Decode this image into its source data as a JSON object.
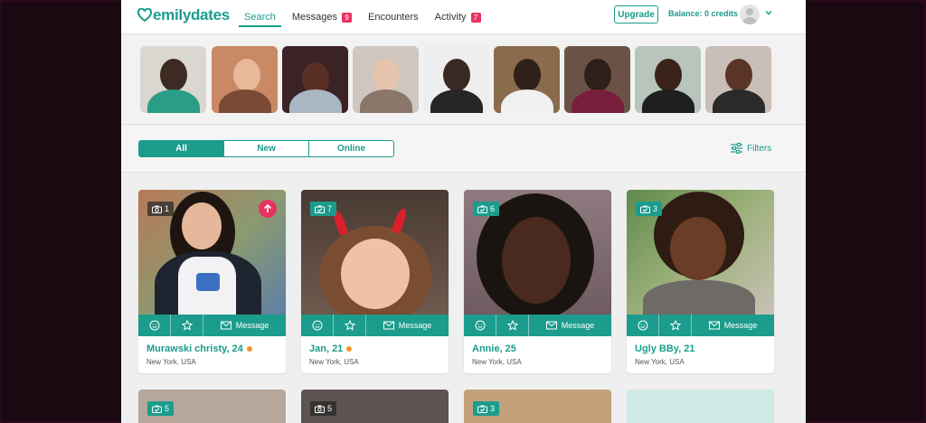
{
  "header": {
    "logo_text": "emilydates",
    "nav": [
      {
        "label": "Search",
        "active": true,
        "badge": ""
      },
      {
        "label": "Messages",
        "active": false,
        "badge": "9"
      },
      {
        "label": "Encounters",
        "active": false,
        "badge": ""
      },
      {
        "label": "Activity",
        "active": false,
        "badge": "7"
      }
    ],
    "upgrade_label": "Upgrade",
    "balance_text": "Balance: 0 credits"
  },
  "stories": [
    {
      "icon": "profile-photo"
    },
    {
      "icon": "profile-photo"
    },
    {
      "icon": "profile-photo"
    },
    {
      "icon": "profile-photo"
    },
    {
      "icon": "profile-photo"
    },
    {
      "icon": "profile-photo"
    },
    {
      "icon": "profile-photo"
    },
    {
      "icon": "profile-photo"
    },
    {
      "icon": "profile-photo"
    }
  ],
  "filter_tabs": [
    {
      "label": "All",
      "active": true
    },
    {
      "label": "New",
      "active": false
    },
    {
      "label": "Online",
      "active": false
    }
  ],
  "filters_label": "Filters",
  "profiles": [
    {
      "name": "Murawski christy, 24",
      "location": "New York, USA",
      "photo_count": "1",
      "count_style": "camera-icon",
      "online": true,
      "boosted": true
    },
    {
      "name": "Jan, 21",
      "location": "New York, USA",
      "photo_count": "7",
      "count_style": "verified-photo-icon",
      "online": true,
      "boosted": false
    },
    {
      "name": "Annie, 25",
      "location": "New York, USA",
      "photo_count": "6",
      "count_style": "verified-photo-icon",
      "online": false,
      "boosted": false
    },
    {
      "name": "Ugly BBy, 21",
      "location": "New York, USA",
      "photo_count": "3",
      "count_style": "verified-photo-icon",
      "online": false,
      "boosted": false
    }
  ],
  "profiles_row2": [
    {
      "photo_count": "5",
      "count_style": "verified-photo-icon"
    },
    {
      "photo_count": "5",
      "count_style": "camera-icon"
    },
    {
      "photo_count": "3",
      "count_style": "verified-photo-icon"
    },
    {
      "photo_count": "",
      "count_style": ""
    }
  ],
  "card_actions": {
    "message_label": "Message"
  },
  "colors": {
    "accent": "#1b9c8c",
    "badge": "#e8325f",
    "online_dot": "#f0952a"
  }
}
